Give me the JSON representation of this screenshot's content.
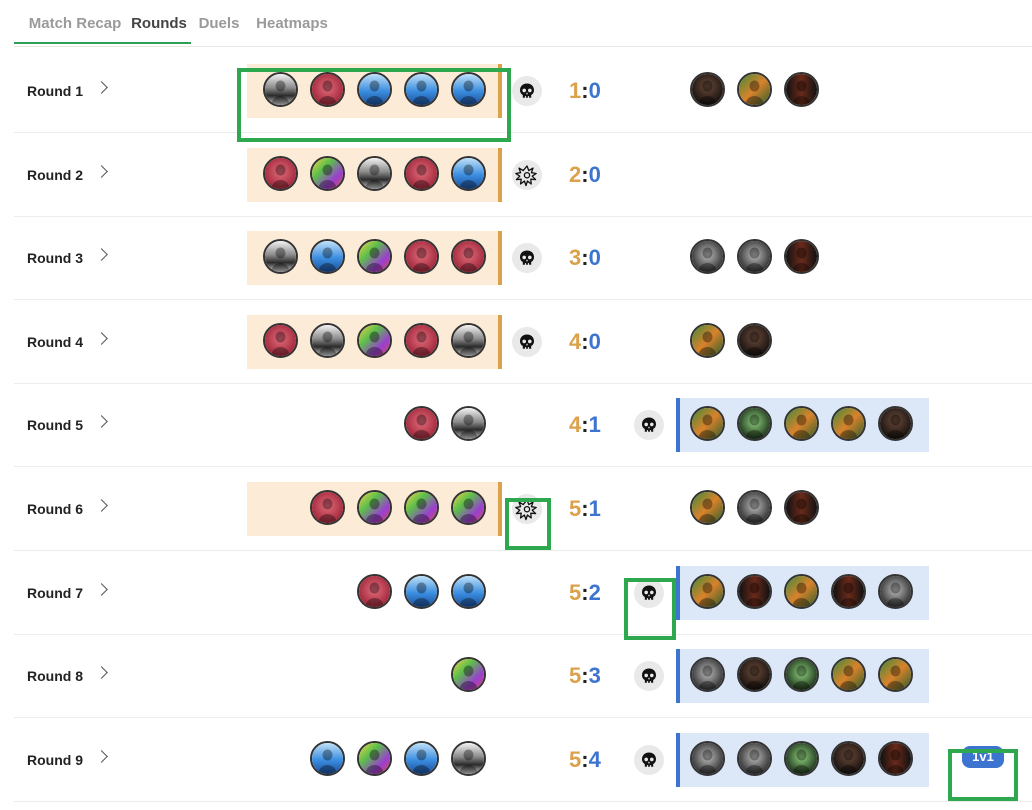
{
  "tabs": [
    {
      "label": "Match Recap",
      "active": false
    },
    {
      "label": "Rounds",
      "active": true
    },
    {
      "label": "Duels",
      "active": false
    },
    {
      "label": "Heatmaps",
      "active": false
    }
  ],
  "colors": {
    "team_a": "#dba24b",
    "team_b": "#3c74cf",
    "band_a": "#fcebd7",
    "band_b": "#dce7f8",
    "highlight": "#2ea84f",
    "tab_underline": "#2e9e58"
  },
  "rounds": [
    {
      "label": "Round 1",
      "winner": "a",
      "outcome_icon": "skull-icon",
      "score_a": "1",
      "score_b": "0",
      "team_a": [
        "a-black-white",
        "a-red",
        "a-blue",
        "a-blue",
        "a-blue"
      ],
      "team_b": [
        "b-dark",
        "b-orange-green",
        "b-black-red"
      ]
    },
    {
      "label": "Round 2",
      "winner": "a",
      "outcome_icon": "explosion-icon",
      "score_a": "2",
      "score_b": "0",
      "team_a": [
        "a-red",
        "a-purple",
        "a-black-white",
        "a-red",
        "a-blue"
      ],
      "team_b": []
    },
    {
      "label": "Round 3",
      "winner": "a",
      "outcome_icon": "skull-icon",
      "score_a": "3",
      "score_b": "0",
      "team_a": [
        "a-black-white",
        "a-blue",
        "a-purple",
        "a-red",
        "a-red"
      ],
      "team_b": [
        "b-gray",
        "b-gray",
        "b-black-red"
      ]
    },
    {
      "label": "Round 4",
      "winner": "a",
      "outcome_icon": "skull-icon",
      "score_a": "4",
      "score_b": "0",
      "team_a": [
        "a-red",
        "a-black-white",
        "a-purple",
        "a-red",
        "a-black-white"
      ],
      "team_b": [
        "b-orange-green",
        "b-dark"
      ]
    },
    {
      "label": "Round 5",
      "winner": "b",
      "outcome_icon": "skull-icon",
      "score_a": "4",
      "score_b": "1",
      "team_a": [
        "a-red",
        "a-black-white"
      ],
      "team_b": [
        "b-orange-green",
        "b-green",
        "b-orange-green",
        "b-orange-green",
        "b-dark"
      ]
    },
    {
      "label": "Round 6",
      "winner": "a",
      "outcome_icon": "explosion-icon",
      "score_a": "5",
      "score_b": "1",
      "team_a": [
        "a-red",
        "a-purple",
        "a-purple",
        "a-purple"
      ],
      "team_b": [
        "b-orange-green",
        "b-gray",
        "b-black-red"
      ]
    },
    {
      "label": "Round 7",
      "winner": "b",
      "outcome_icon": "skull-icon",
      "score_a": "5",
      "score_b": "2",
      "team_a": [
        "a-red",
        "a-blue",
        "a-blue"
      ],
      "team_b": [
        "b-orange-green",
        "b-black-red",
        "b-orange-green",
        "b-black-red",
        "b-gray"
      ]
    },
    {
      "label": "Round 8",
      "winner": "b",
      "outcome_icon": "skull-icon",
      "score_a": "5",
      "score_b": "3",
      "team_a": [
        "a-purple"
      ],
      "team_b": [
        "b-gray",
        "b-dark",
        "b-green",
        "b-orange-green",
        "b-orange-green"
      ]
    },
    {
      "label": "Round 9",
      "winner": "b",
      "outcome_icon": "skull-icon",
      "score_a": "5",
      "score_b": "4",
      "team_a": [
        "a-blue",
        "a-purple",
        "a-blue",
        "a-black-white"
      ],
      "team_b": [
        "b-gray",
        "b-gray",
        "b-green",
        "b-dark",
        "b-black-red"
      ],
      "badge": "1v1"
    }
  ]
}
